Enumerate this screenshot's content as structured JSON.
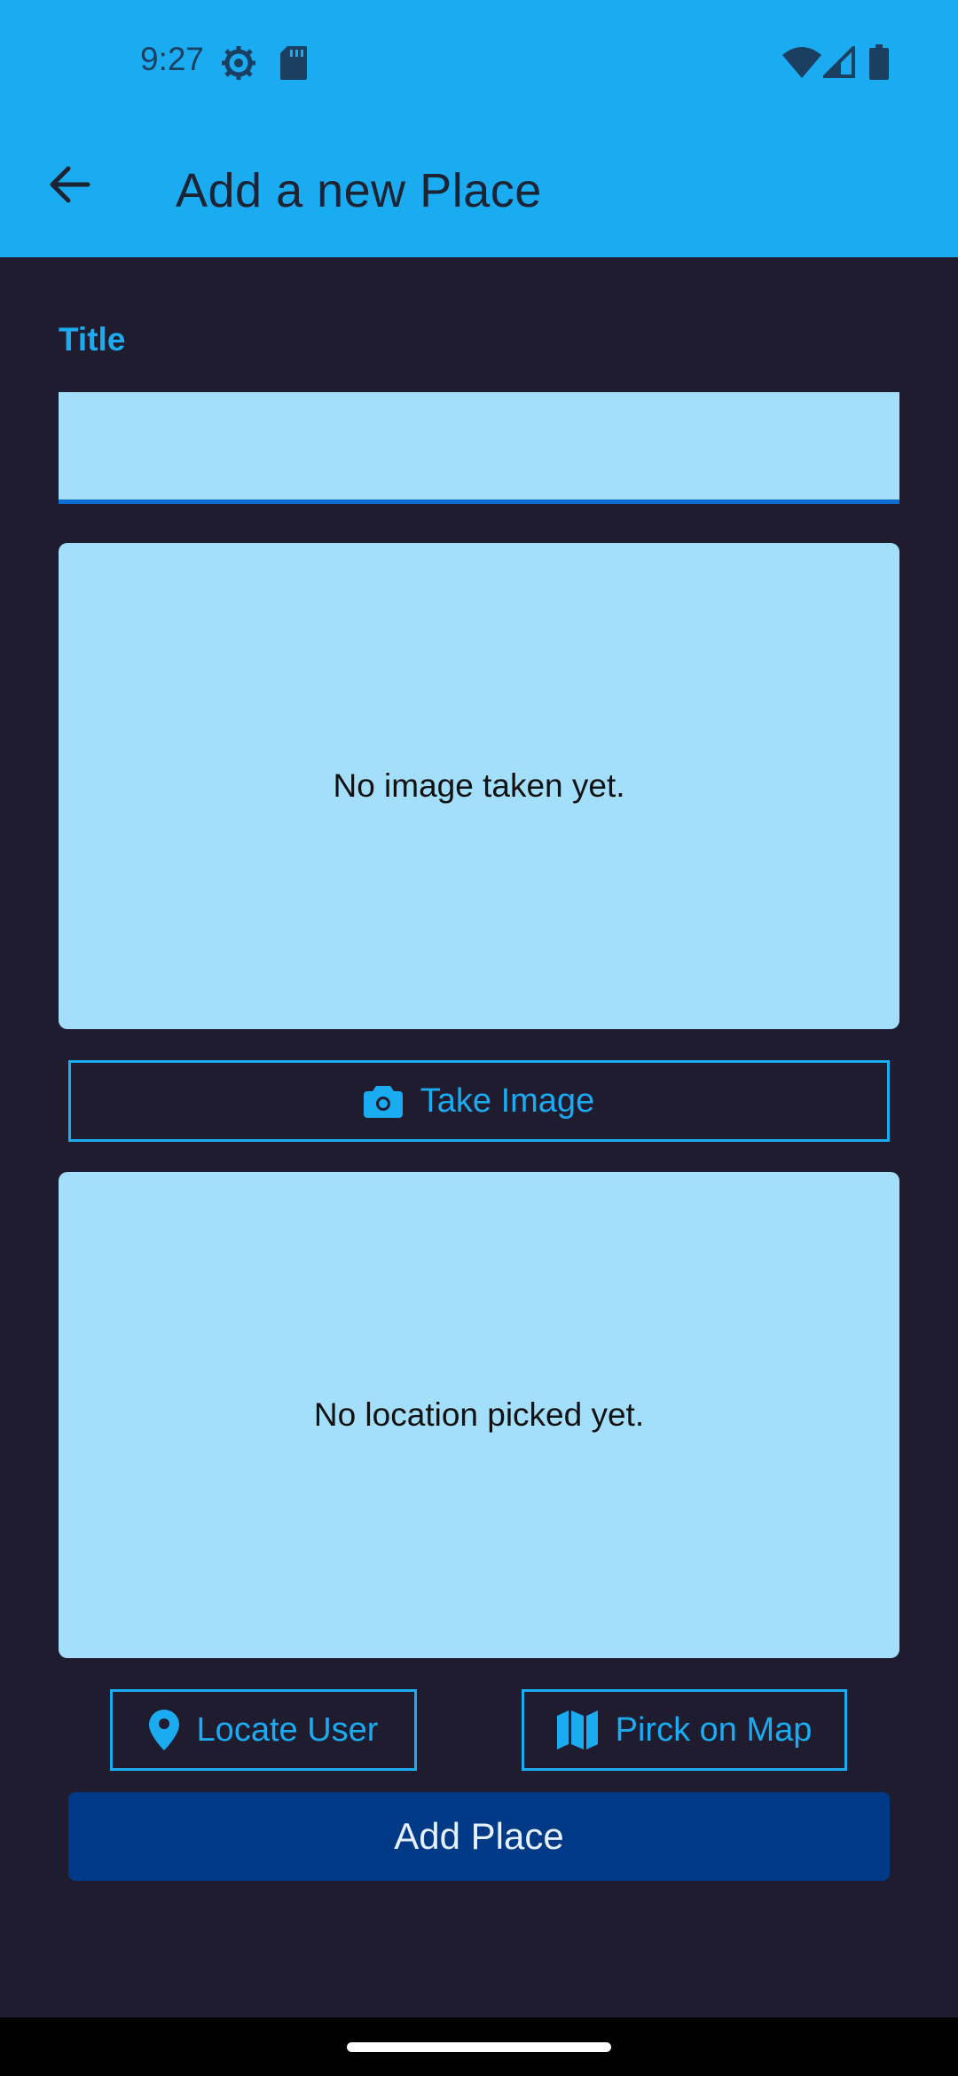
{
  "status_bar": {
    "time": "9:27",
    "icons": [
      "settings-gear-icon",
      "sd-card-icon",
      "wifi-icon",
      "cellular-signal-icon",
      "battery-icon"
    ]
  },
  "app_bar": {
    "back_icon": "arrow-back-icon",
    "title": "Add a new Place"
  },
  "form": {
    "title_label": "Title",
    "title_value": ""
  },
  "image_preview": {
    "placeholder": "No image taken yet."
  },
  "take_image_button": {
    "icon": "camera-icon",
    "label": "Take Image"
  },
  "location_preview": {
    "placeholder": "No location picked yet."
  },
  "location_buttons": {
    "locate_user": {
      "icon": "location-pin-icon",
      "label": "Locate User"
    },
    "pick_on_map": {
      "icon": "map-icon",
      "label": "Pirck on Map"
    }
  },
  "add_place_button": {
    "label": "Add Place"
  },
  "colors": {
    "primary": "#1AABF1",
    "background": "#201C30",
    "preview_fill": "#A3DFFA",
    "input_underline": "#0D6FD3",
    "add_button": "#003A87"
  }
}
